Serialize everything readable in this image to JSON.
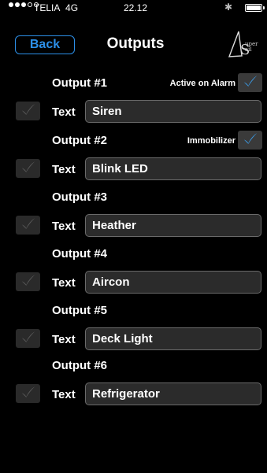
{
  "status_bar": {
    "carrier": "TELIA",
    "network": "4G",
    "time": "22.12",
    "bluetooth_glyph": "✱",
    "signal_dots_filled": 3,
    "signal_dots_total": 5,
    "battery_level": 1.0
  },
  "nav": {
    "back_label": "Back",
    "title": "Outputs",
    "logo_text_line1": "uper",
    "logo_text_line2": "ail"
  },
  "colors": {
    "accent": "#2c8fe8",
    "check_active": "#3a9be6",
    "check_inactive": "#5a5a5a"
  },
  "outputs": [
    {
      "title": "Output #1",
      "text_label": "Text",
      "value": "Siren",
      "enabled": false,
      "alarm_label": "Active on Alarm",
      "alarm_checked": true
    },
    {
      "title": "Output #2",
      "text_label": "Text",
      "value": "Blink LED",
      "enabled": false,
      "alarm_label": "Immobilizer",
      "alarm_checked": true
    },
    {
      "title": "Output #3",
      "text_label": "Text",
      "value": "Heather",
      "enabled": false
    },
    {
      "title": "Output #4",
      "text_label": "Text",
      "value": "Aircon",
      "enabled": false
    },
    {
      "title": "Output #5",
      "text_label": "Text",
      "value": "Deck Light",
      "enabled": false
    },
    {
      "title": "Output #6",
      "text_label": "Text",
      "value": "Refrigerator",
      "enabled": false
    }
  ]
}
